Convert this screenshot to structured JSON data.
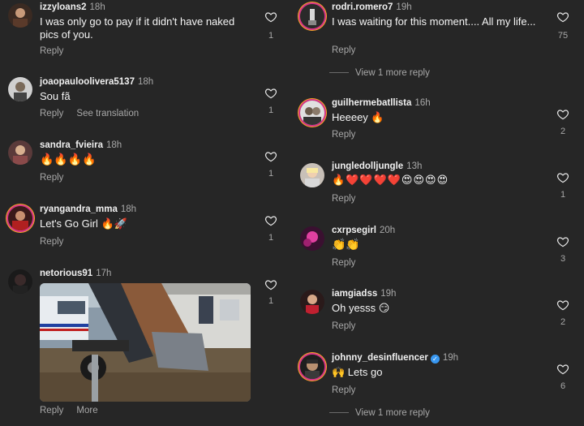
{
  "left": [
    {
      "user": "izzyloans2",
      "time": "18h",
      "text": "I was only go to pay if it didn't have naked pics of you.",
      "reply": "Reply",
      "count": "1"
    },
    {
      "user": "joaopauloolivera5137",
      "time": "18h",
      "text": "Sou fã",
      "reply": "Reply",
      "translate": "See translation",
      "count": "1"
    },
    {
      "user": "sandra_fvieira",
      "time": "18h",
      "text": "🔥🔥🔥🔥",
      "reply": "Reply",
      "count": "1"
    },
    {
      "user": "ryangandra_mma",
      "time": "18h",
      "text": "Let's Go Girl 🔥🚀",
      "reply": "Reply",
      "count": "1"
    },
    {
      "user": "netorious91",
      "time": "17h",
      "text": "",
      "reply": "Reply",
      "more": "More",
      "count": "1"
    }
  ],
  "right": [
    {
      "user": "rodri.romero7",
      "time": "19h",
      "text": "I was waiting for this moment.... All my life...",
      "reply": "Reply",
      "count": "75",
      "view_more": "View 1 more reply"
    },
    {
      "user": "guilhermebatllista",
      "time": "16h",
      "text": "Heeeey 🔥",
      "reply": "Reply",
      "count": "2"
    },
    {
      "user": "jungledolljungle",
      "time": "13h",
      "text": "🔥❤️❤️❤️❤️😍😍😍😍",
      "reply": "Reply",
      "count": "1"
    },
    {
      "user": "cxrpsegirl",
      "time": "20h",
      "text": "👏👏",
      "reply": "Reply",
      "count": "3"
    },
    {
      "user": "iamgiadss",
      "time": "19h",
      "text": "Oh yesss 😏",
      "reply": "Reply",
      "count": "2"
    },
    {
      "user": "johnny_desinfluencer",
      "time": "19h",
      "verified": true,
      "text": "🙌 Lets go",
      "reply": "Reply",
      "count": "6",
      "view_more": "View 1 more reply"
    }
  ],
  "colors": {
    "background": "#262626",
    "muted": "#a8a8a8",
    "verified": "#3897f0"
  }
}
